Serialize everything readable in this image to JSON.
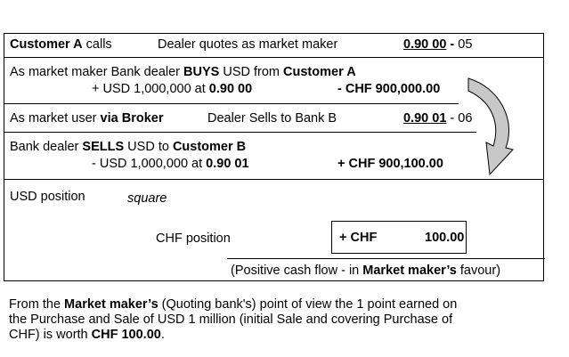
{
  "rows": {
    "r1": {
      "customer": "Customer A",
      "calls": "calls",
      "quote_text": "Dealer quotes as market maker",
      "price": "0.90 00",
      "dash": "-",
      "spread": "05"
    },
    "r2": {
      "prefix": "As market maker Bank dealer ",
      "buys": "BUYS",
      "mid": " USD from ",
      "customer": "Customer A"
    },
    "r3": {
      "usd_text": "+ USD 1,000,000 at ",
      "rate": "0.90 00",
      "chf": "- CHF 900,000.00"
    },
    "r4": {
      "prefix": "As market user ",
      "broker": "via Broker",
      "dealer_text": "Dealer Sells to Bank B",
      "price": "0.90 01",
      "dash": " - ",
      "spread": "06"
    },
    "r5": {
      "prefix": "Bank dealer ",
      "sells": "SELLS",
      "mid": " USD  to ",
      "customer": "Customer B"
    },
    "r6": {
      "usd_text": "- USD 1,000,000 at ",
      "rate": "0.90 01",
      "chf": "+ CHF 900,100.00"
    },
    "r7": {
      "label": "USD position",
      "status": "square"
    },
    "r8": {
      "label": "CHF position",
      "box_sign": "+ CHF",
      "box_value": "100.00"
    },
    "r9": {
      "open": "(Positive cash flow - in ",
      "mm": "Market maker’s",
      "close": " favour)"
    }
  },
  "note": {
    "l1_a": "From the ",
    "l1_b": "Market maker’s",
    "l1_c": " (Quoting bank's) point of view the 1 point earned on",
    "l2": "the Purchase and Sale of USD 1 million (initial Sale and covering Purchase of",
    "l3_a": "CHF) is worth ",
    "l3_b": "CHF 100.00",
    "l3_c": "."
  },
  "colors": {
    "arrow_fill": "#c8c8c8",
    "border": "#000000"
  }
}
